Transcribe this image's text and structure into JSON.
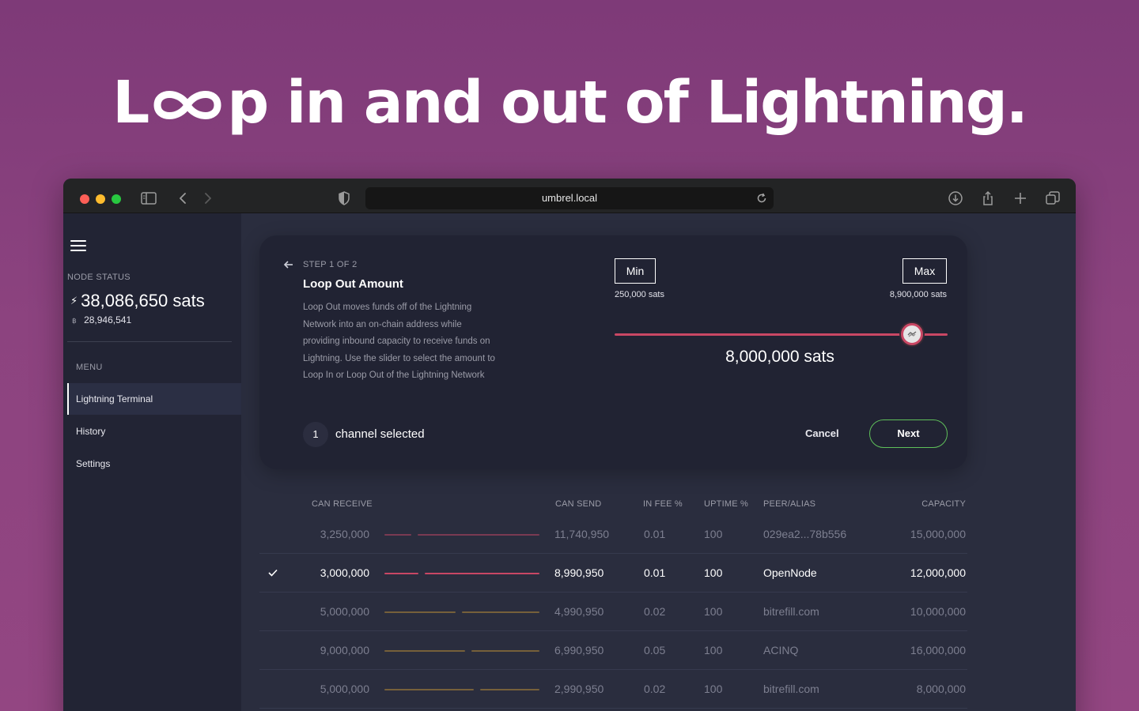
{
  "hero": {
    "before": "L",
    "after": "p in and out of Lightning."
  },
  "browser": {
    "url": "umbrel.local"
  },
  "sidebar": {
    "node_status_label": "NODE STATUS",
    "balance": "38,086,650 sats",
    "btc_balance": "28,946,541",
    "menu_label": "MENU",
    "items": [
      {
        "label": "Lightning Terminal",
        "active": true
      },
      {
        "label": "History",
        "active": false
      },
      {
        "label": "Settings",
        "active": false
      }
    ]
  },
  "card": {
    "step": "STEP 1 OF 2",
    "title": "Loop Out Amount",
    "description": "Loop Out moves funds off of the Lightning Network into an on-chain address while providing inbound capacity to receive funds on Lightning. Use the slider to select the amount to Loop In or Loop Out of the Lightning Network",
    "channels_selected_count": "1",
    "channels_selected_label": "channel selected",
    "min_label": "Min",
    "max_label": "Max",
    "min_value": "250,000 sats",
    "max_value": "8,900,000 sats",
    "slider_fraction": 0.893,
    "amount": "8,000,000 sats",
    "cancel_label": "Cancel",
    "next_label": "Next",
    "accent_color": "#c94764",
    "next_color": "#5fbf5a"
  },
  "table": {
    "headers": [
      "CAN RECEIVE",
      "CAN SEND",
      "IN FEE %",
      "UPTIME %",
      "PEER/ALIAS",
      "CAPACITY"
    ],
    "rows": [
      {
        "can_receive": "3,250,000",
        "can_send": "11,740,950",
        "in_fee": "0.01",
        "uptime": "100",
        "peer": "029ea2...78b556",
        "capacity": "15,000,000",
        "selected": false,
        "bar_color": "#7a3a52",
        "receive_fraction": 0.18
      },
      {
        "can_receive": "3,000,000",
        "can_send": "8,990,950",
        "in_fee": "0.01",
        "uptime": "100",
        "peer": "OpenNode",
        "capacity": "12,000,000",
        "selected": true,
        "bar_color": "#c94764",
        "receive_fraction": 0.23
      },
      {
        "can_receive": "5,000,000",
        "can_send": "4,990,950",
        "in_fee": "0.02",
        "uptime": "100",
        "peer": "bitrefill.com",
        "capacity": "10,000,000",
        "selected": false,
        "bar_color": "#76603a",
        "receive_fraction": 0.48
      },
      {
        "can_receive": "9,000,000",
        "can_send": "6,990,950",
        "in_fee": "0.05",
        "uptime": "100",
        "peer": "ACINQ",
        "capacity": "16,000,000",
        "selected": false,
        "bar_color": "#76603a",
        "receive_fraction": 0.54
      },
      {
        "can_receive": "5,000,000",
        "can_send": "2,990,950",
        "in_fee": "0.02",
        "uptime": "100",
        "peer": "bitrefill.com",
        "capacity": "8,000,000",
        "selected": false,
        "bar_color": "#76603a",
        "receive_fraction": 0.6
      }
    ]
  }
}
